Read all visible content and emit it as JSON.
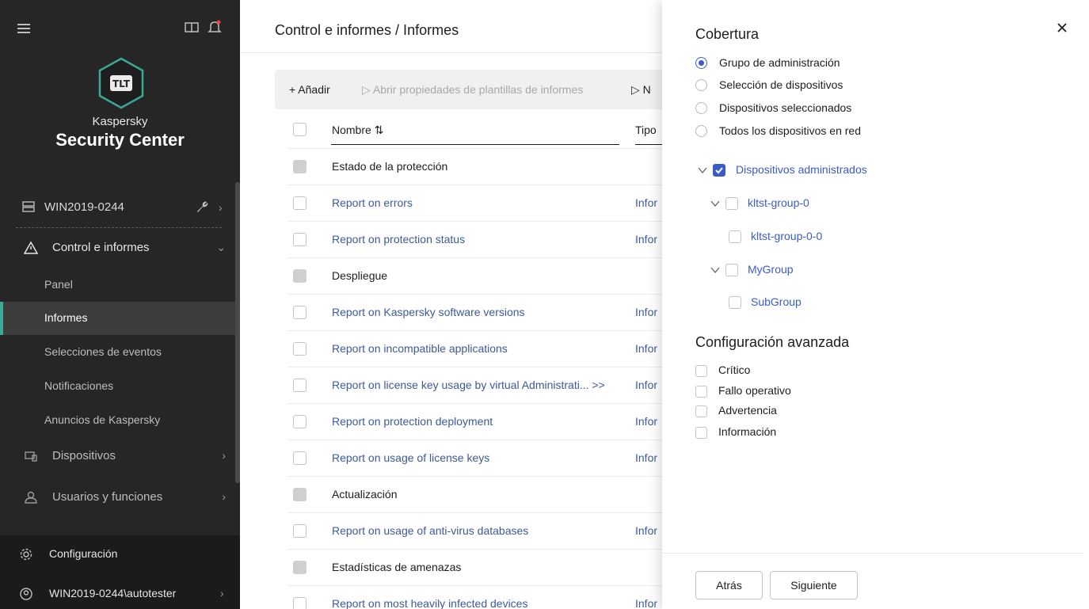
{
  "sidebar": {
    "brand_small": "Kaspersky",
    "brand_big": "Security Center",
    "logo_text": "TLT",
    "server": {
      "label": "WIN2019-0244"
    },
    "section": {
      "label": "Control e informes"
    },
    "sub_items": [
      {
        "label": "Panel"
      },
      {
        "label": "Informes"
      },
      {
        "label": "Selecciones de eventos"
      },
      {
        "label": "Notificaciones"
      },
      {
        "label": "Anuncios de Kaspersky"
      }
    ],
    "devices": {
      "label": "Dispositivos"
    },
    "users": {
      "label": "Usuarios y funciones"
    },
    "settings": {
      "label": "Configuración"
    },
    "account": {
      "label": "WIN2019-0244\\autotester"
    }
  },
  "main": {
    "breadcrumb": "Control e informes / Informes",
    "toolbar": {
      "add": "+ Añadir",
      "open": "▷ Abrir propiedades de plantillas de informes",
      "n": "▷ N"
    },
    "columns": {
      "name": "Nombre ⇅",
      "type": "Tipo"
    },
    "rows": [
      {
        "name": "Estado de la protección",
        "type": "",
        "kind": "group"
      },
      {
        "name": "Report on errors",
        "type": "Infor",
        "kind": "link"
      },
      {
        "name": "Report on protection status",
        "type": "Infor",
        "kind": "link"
      },
      {
        "name": "Despliegue",
        "type": "",
        "kind": "group"
      },
      {
        "name": "Report on Kaspersky software versions",
        "type": "Infor",
        "kind": "link"
      },
      {
        "name": "Report on incompatible applications",
        "type": "Infor",
        "kind": "link"
      },
      {
        "name": "Report on license key usage by virtual Administrati...  >>",
        "type": "Infor",
        "kind": "link"
      },
      {
        "name": "Report on protection deployment",
        "type": "Infor",
        "kind": "link"
      },
      {
        "name": "Report on usage of license keys",
        "type": "Infor",
        "kind": "link"
      },
      {
        "name": "Actualización",
        "type": "",
        "kind": "group"
      },
      {
        "name": "Report on usage of anti-virus databases",
        "type": "Infor",
        "kind": "link"
      },
      {
        "name": "Estadísticas de amenazas",
        "type": "",
        "kind": "group"
      },
      {
        "name": "Report on most heavily infected devices",
        "type": "Infor",
        "kind": "link"
      }
    ]
  },
  "drawer": {
    "title": "Cobertura",
    "radios": [
      {
        "label": "Grupo de administración",
        "selected": true
      },
      {
        "label": "Selección de dispositivos",
        "selected": false
      },
      {
        "label": "Dispositivos seleccionados",
        "selected": false
      },
      {
        "label": "Todos los dispositivos en red",
        "selected": false
      }
    ],
    "tree": [
      {
        "label": "Dispositivos administrados",
        "checked": true
      },
      {
        "label": "kltst-group-0",
        "checked": false
      },
      {
        "label": "kltst-group-0-0",
        "checked": false
      },
      {
        "label": "MyGroup",
        "checked": false
      },
      {
        "label": "SubGroup",
        "checked": false
      }
    ],
    "advanced_title": "Configuración avanzada",
    "advanced": [
      {
        "label": "Crítico"
      },
      {
        "label": "Fallo operativo"
      },
      {
        "label": "Advertencia"
      },
      {
        "label": "Información"
      }
    ],
    "buttons": {
      "back": "Atrás",
      "next": "Siguiente"
    }
  },
  "colors": {
    "sidebar_bg": "#262626",
    "accent": "#3a5cc8",
    "link": "#3d5a99",
    "active_marker": "#3ca898"
  }
}
